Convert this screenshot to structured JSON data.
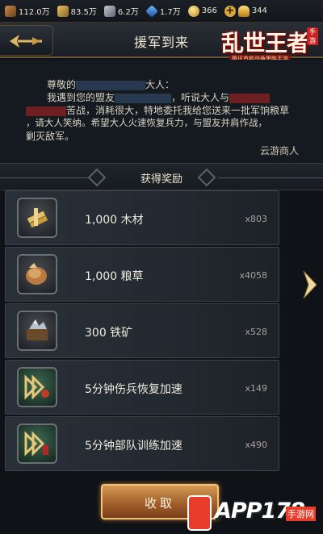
{
  "resources": [
    {
      "icon": "wood-icon",
      "value": "112.0万"
    },
    {
      "icon": "grain-icon",
      "value": "83.5万"
    },
    {
      "icon": "iron-icon",
      "value": "6.2万"
    },
    {
      "icon": "crystal-icon",
      "value": "1.7万"
    },
    {
      "icon": "coin-icon",
      "value": "366"
    },
    {
      "icon": "ingot-icon",
      "value": "344"
    }
  ],
  "header": {
    "title": "援军到来"
  },
  "logo": {
    "text": "乱世王者",
    "tagline": "腾讯首款战争策略手游",
    "seal": "手游"
  },
  "letter": {
    "greeting_a": "尊敬的",
    "greeting_b": "大人：",
    "l2a": "我遇到您的盟友",
    "l2b": "，听说大人与",
    "l3": "苦战，消耗很大，特地委托我给您送来一批军饷粮草",
    "l4": "，请大人笑纳。希望大人火速恢复兵力，与盟友并肩作战，",
    "l5": "剿灭敌军。",
    "signature": "云游商人"
  },
  "rewards_title": "获得奖励",
  "rewards": [
    {
      "name": "1,000  木材",
      "qty": "x803",
      "icon": "wood-bundle-icon"
    },
    {
      "name": "1,000  粮草",
      "qty": "x4058",
      "icon": "grain-sack-icon"
    },
    {
      "name": "300  铁矿",
      "qty": "x528",
      "icon": "iron-ore-chest-icon"
    },
    {
      "name": "5分钟伤兵恢复加速",
      "qty": "x149",
      "icon": "heal-speedup-icon"
    },
    {
      "name": "5分钟部队训练加速",
      "qty": "x490",
      "icon": "train-speedup-icon"
    }
  ],
  "claim_label": "收取",
  "watermark": {
    "text": "APP178",
    "sub": "手游网"
  },
  "colors": {
    "accent_gold": "#d8a73a",
    "claim_orange": "#a25f2c",
    "panel": "#232930"
  }
}
